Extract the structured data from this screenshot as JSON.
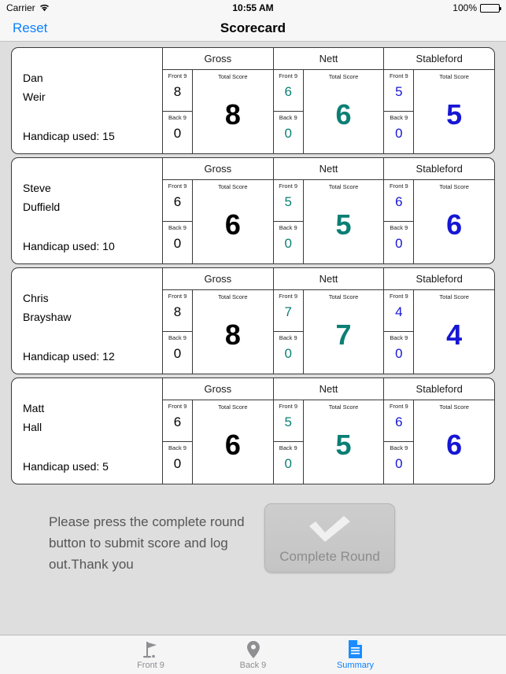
{
  "status_bar": {
    "carrier": "Carrier",
    "wifi_icon": "wifi-icon",
    "time": "10:55 AM",
    "battery_percent": "100%",
    "battery_icon": "battery-full-icon"
  },
  "nav_bar": {
    "reset_label": "Reset",
    "title": "Scorecard"
  },
  "colors": {
    "gross": "#000000",
    "nett": "#0b7f74",
    "stableford": "#1616d4",
    "accent": "#0b81fe",
    "background": "#dedede"
  },
  "labels": {
    "front9": "Front 9",
    "back9": "Back 9",
    "total_score": "Total Score",
    "gross": "Gross",
    "nett": "Nett",
    "stableford": "Stableford",
    "handicap_prefix": "Handicap used: "
  },
  "players": [
    {
      "first_name": "Dan",
      "last_name": "Weir",
      "handicap_text": "Handicap used: 15",
      "gross": {
        "title": "Gross",
        "front9": "8",
        "back9": "0",
        "total": "8"
      },
      "nett": {
        "title": "Nett",
        "front9": "6",
        "back9": "0",
        "total": "6"
      },
      "stableford": {
        "title": "Stableford",
        "front9": "5",
        "back9": "0",
        "total": "5"
      }
    },
    {
      "first_name": "Steve",
      "last_name": "Duffield",
      "handicap_text": "Handicap used: 10",
      "gross": {
        "title": "Gross",
        "front9": "6",
        "back9": "0",
        "total": "6"
      },
      "nett": {
        "title": "Nett",
        "front9": "5",
        "back9": "0",
        "total": "5"
      },
      "stableford": {
        "title": "Stableford",
        "front9": "6",
        "back9": "0",
        "total": "6"
      }
    },
    {
      "first_name": "Chris",
      "last_name": "Brayshaw",
      "handicap_text": "Handicap used: 12",
      "gross": {
        "title": "Gross",
        "front9": "8",
        "back9": "0",
        "total": "8"
      },
      "nett": {
        "title": "Nett",
        "front9": "7",
        "back9": "0",
        "total": "7"
      },
      "stableford": {
        "title": "Stableford",
        "front9": "4",
        "back9": "0",
        "total": "4"
      }
    },
    {
      "first_name": "Matt",
      "last_name": "Hall",
      "handicap_text": "Handicap used: 5",
      "gross": {
        "title": "Gross",
        "front9": "6",
        "back9": "0",
        "total": "6"
      },
      "nett": {
        "title": "Nett",
        "front9": "5",
        "back9": "0",
        "total": "5"
      },
      "stableford": {
        "title": "Stableford",
        "front9": "6",
        "back9": "0",
        "total": "6"
      }
    }
  ],
  "footer": {
    "message": "Please press the complete round button to submit score and log out.Thank you",
    "complete_button_label": "Complete Round",
    "complete_button_icon": "checkmark-icon"
  },
  "tab_bar": {
    "items": [
      {
        "label": "Front 9",
        "icon": "golf-flag-icon",
        "active": false
      },
      {
        "label": "Back 9",
        "icon": "map-pin-icon",
        "active": false
      },
      {
        "label": "Summary",
        "icon": "document-icon",
        "active": true
      }
    ]
  }
}
